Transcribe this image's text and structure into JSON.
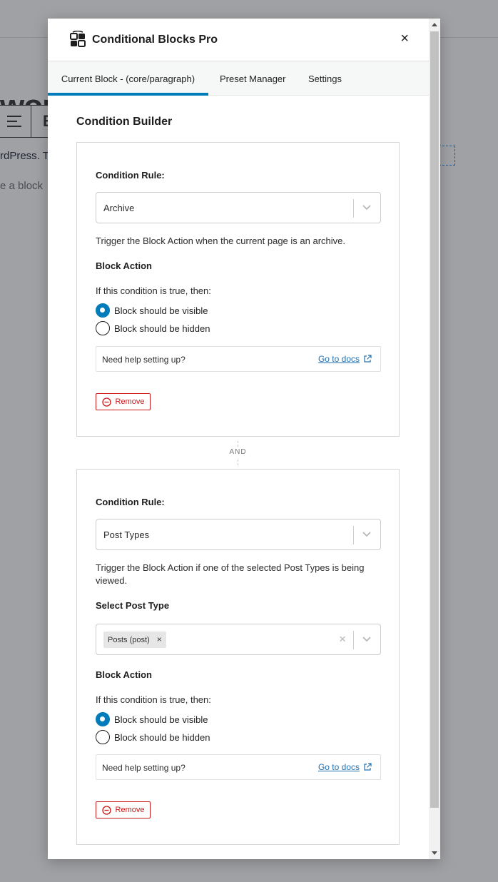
{
  "background": {
    "heading_fragment": "wor",
    "toolbar_bold": "B",
    "paragraph_fragment": "rdPress. T",
    "add_block_fragment": "e a block"
  },
  "modal": {
    "title": "Conditional Blocks Pro",
    "close_label": "×",
    "logo_icon": "conditional-blocks-logo-icon"
  },
  "tabs": [
    {
      "label": "Current Block - (core/paragraph)",
      "active": true
    },
    {
      "label": "Preset Manager",
      "active": false
    },
    {
      "label": "Settings",
      "active": false
    }
  ],
  "builder": {
    "title": "Condition Builder",
    "conditions": [
      {
        "rule_label": "Condition Rule:",
        "rule_value": "Archive",
        "description": "Trigger the Block Action when the current page is an archive.",
        "action_label": "Block Action",
        "action_prompt": "If this condition is true, then:",
        "options": [
          "Block should be visible",
          "Block should be hidden"
        ],
        "selected_option": "Block should be visible",
        "help_text": "Need help setting up?",
        "docs_link": "Go to docs",
        "remove_label": "Remove"
      },
      {
        "rule_label": "Condition Rule:",
        "rule_value": "Post Types",
        "description": "Trigger the Block Action if one of the selected Post Types is being viewed.",
        "post_type_label": "Select Post Type",
        "post_types_selected": [
          "Posts (post)"
        ],
        "chip_remove": "×",
        "clear_all": "×",
        "action_label": "Block Action",
        "action_prompt": "If this condition is true, then:",
        "options": [
          "Block should be visible",
          "Block should be hidden"
        ],
        "selected_option": "Block should be visible",
        "help_text": "Need help setting up?",
        "docs_link": "Go to docs",
        "remove_label": "Remove"
      }
    ],
    "joiner": "AND"
  },
  "colors": {
    "accent": "#007cba",
    "danger": "#cc1818",
    "link": "#2271b1"
  }
}
